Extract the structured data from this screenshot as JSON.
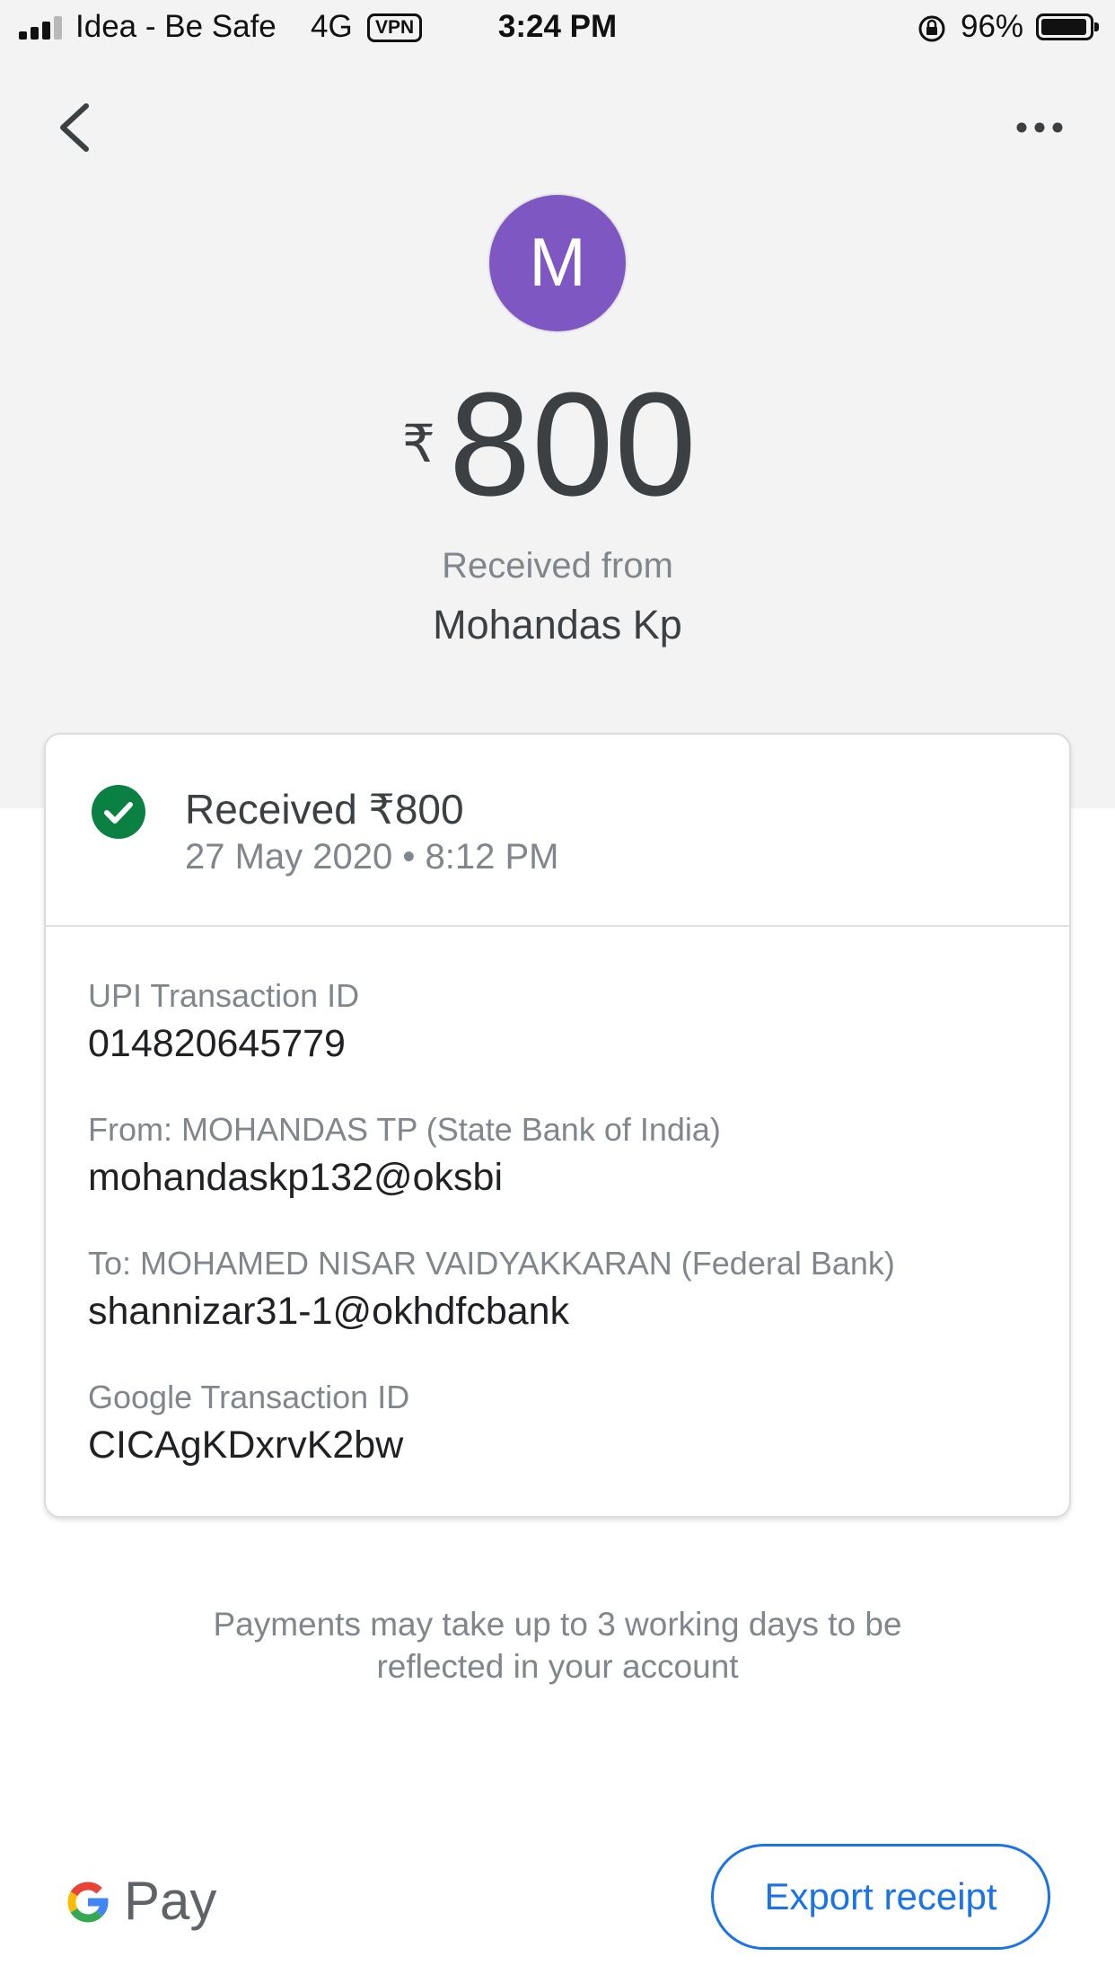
{
  "status_bar": {
    "carrier": "Idea - Be Safe",
    "network": "4G",
    "vpn": "VPN",
    "time": "3:24 PM",
    "battery": "96%"
  },
  "header": {
    "avatar_letter": "M",
    "currency_symbol": "₹",
    "amount": "800",
    "received_from_label": "Received from",
    "sender_name": "Mohandas Kp"
  },
  "card": {
    "status_title": "Received ₹800",
    "status_datetime": "27 May 2020 • 8:12 PM",
    "details": [
      {
        "label": "UPI Transaction ID",
        "value": "014820645779"
      },
      {
        "label": "From: MOHANDAS  TP (State Bank of India)",
        "value": "mohandaskp132@oksbi"
      },
      {
        "label": "To: MOHAMED NISAR VAIDYAKKARAN (Federal Bank)",
        "value": "shannizar31-1@okhdfcbank"
      },
      {
        "label": "Google Transaction ID",
        "value": "CICAgKDxrvK2bw"
      }
    ]
  },
  "note": {
    "line1": "Payments may take up to 3 working days to be",
    "line2": "reflected in your account"
  },
  "footer": {
    "brand": "Pay",
    "export_label": "Export receipt"
  },
  "colors": {
    "avatar": "#7e57c2",
    "success": "#0b8043",
    "accent": "#1a73e8"
  },
  "icons": [
    "signal-icon",
    "lock-rotation-icon",
    "battery-icon",
    "back-arrow-icon",
    "more-options-icon",
    "check-circle-icon",
    "google-g-icon"
  ]
}
